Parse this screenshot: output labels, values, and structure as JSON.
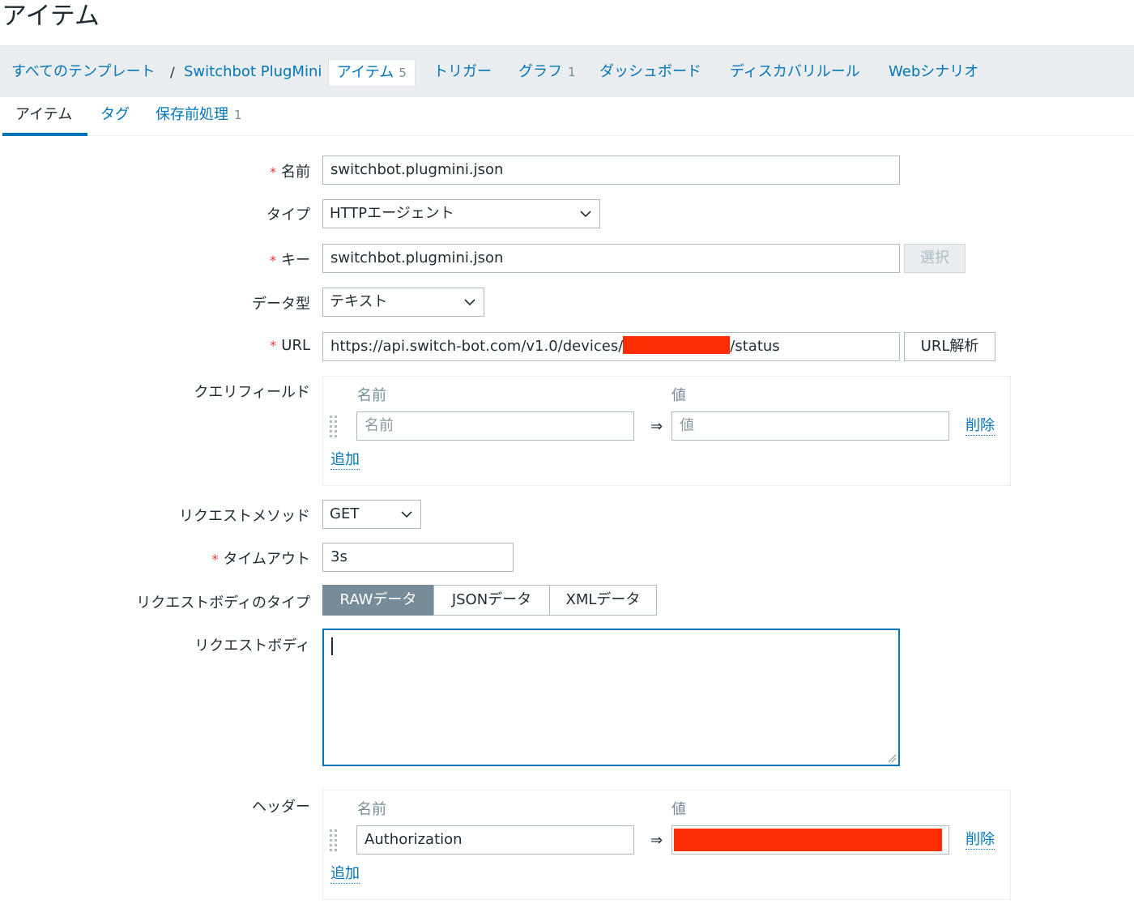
{
  "page": {
    "title": "アイテム"
  },
  "nav": {
    "breadcrumb_all": "すべてのテンプレート",
    "separator": "/",
    "template": "Switchbot PlugMini",
    "items_label": "アイテム",
    "items_count": "5",
    "triggers": "トリガー",
    "graphs": "グラフ",
    "graphs_count": "1",
    "dashboards": "ダッシュボード",
    "discovery": "ディスカバリルール",
    "web": "Webシナリオ"
  },
  "tabs": {
    "item": "アイテム",
    "tags": "タグ",
    "preprocessing": "保存前処理",
    "preprocessing_count": "1"
  },
  "form": {
    "name": {
      "label": "名前",
      "value": "switchbot.plugmini.json"
    },
    "type": {
      "label": "タイプ",
      "value": "HTTPエージェント"
    },
    "key": {
      "label": "キー",
      "value": "switchbot.plugmini.json",
      "select_button": "選択"
    },
    "value_type": {
      "label": "データ型",
      "value": "テキスト"
    },
    "url": {
      "label": "URL",
      "prefix": "https://api.switch-bot.com/v1.0/devices/",
      "suffix": "/status",
      "parse_button": "URL解析"
    },
    "query_fields": {
      "label": "クエリフィールド",
      "col_name": "名前",
      "col_value": "値",
      "name_placeholder": "名前",
      "value_placeholder": "値",
      "arrow": "⇒",
      "remove": "削除",
      "add": "追加"
    },
    "request_method": {
      "label": "リクエストメソッド",
      "value": "GET"
    },
    "timeout": {
      "label": "タイムアウト",
      "value": "3s"
    },
    "body_type": {
      "label": "リクエストボディのタイプ",
      "options": [
        "RAWデータ",
        "JSONデータ",
        "XMLデータ"
      ],
      "selected": "RAWデータ"
    },
    "body": {
      "label": "リクエストボディ",
      "value": ""
    },
    "headers": {
      "label": "ヘッダー",
      "col_name": "名前",
      "col_value": "値",
      "name_value": "Authorization",
      "arrow": "⇒",
      "remove": "削除",
      "add": "追加"
    }
  },
  "colors": {
    "link": "#0275b8",
    "required": "#e33734",
    "redaction": "#fc2c03",
    "segment_active": "#768d99"
  }
}
